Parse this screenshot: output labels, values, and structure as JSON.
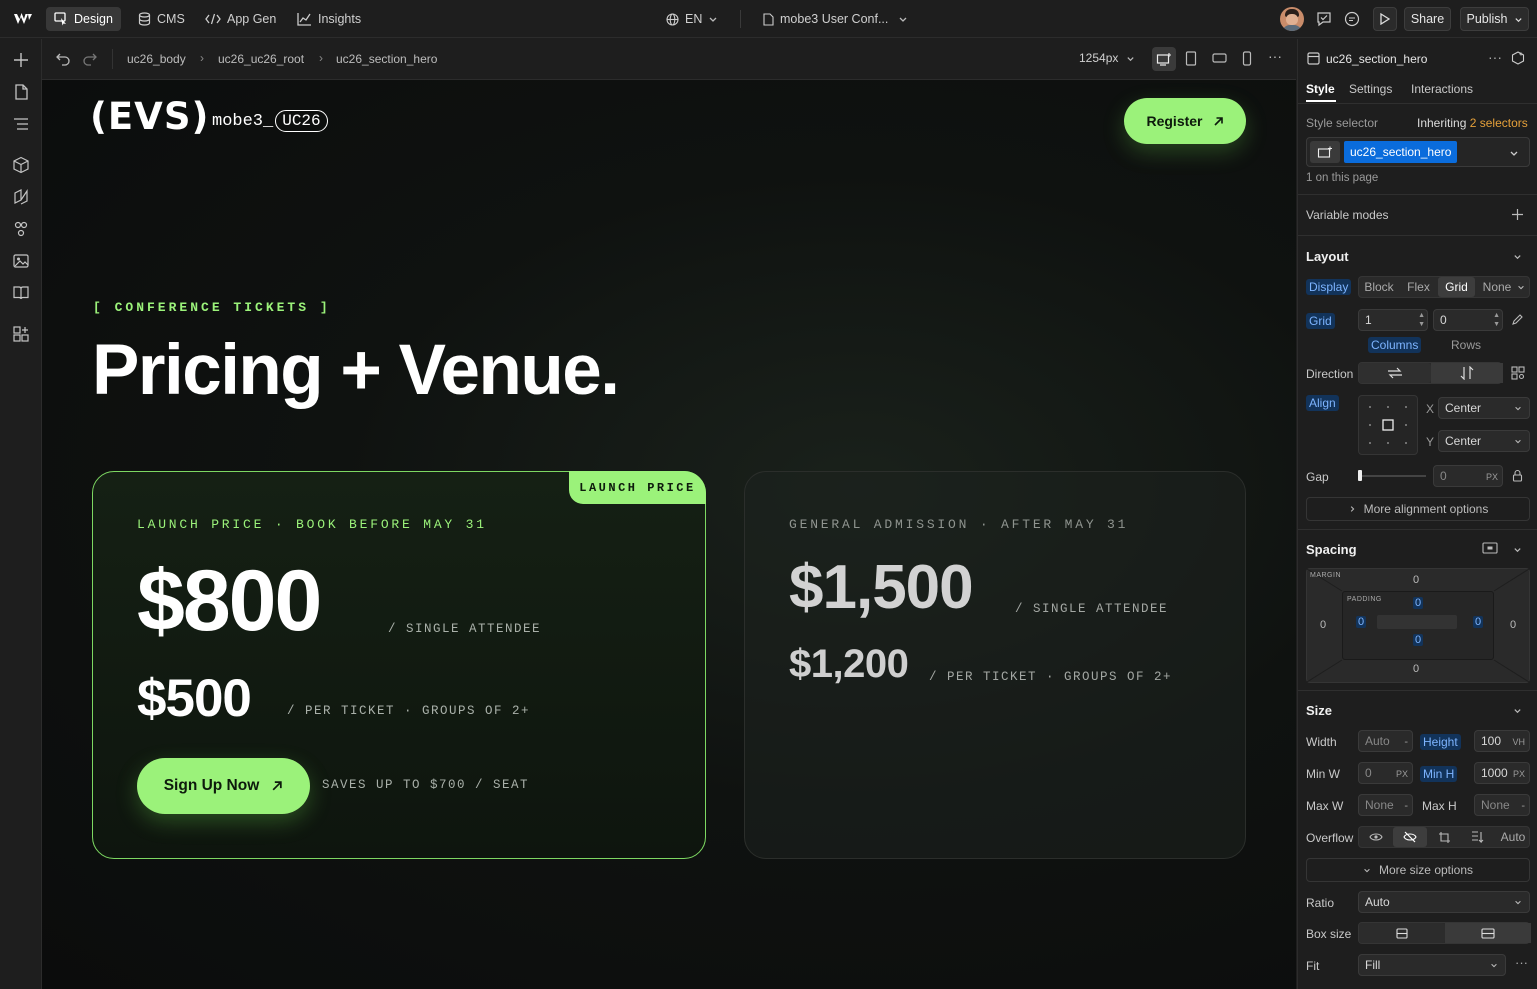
{
  "topbar": {
    "tabs": [
      {
        "label": "Design",
        "icon": "design-cursor-icon"
      },
      {
        "label": "CMS",
        "icon": "database-icon"
      },
      {
        "label": "App Gen",
        "icon": "code-icon"
      },
      {
        "label": "Insights",
        "icon": "chart-icon"
      }
    ],
    "language": "EN",
    "page_name": "mobe3 User Conf...",
    "share_label": "Share",
    "publish_label": "Publish"
  },
  "canvas_header": {
    "breadcrumbs": [
      "uc26_body",
      "uc26_uc26_root",
      "uc26_section_hero"
    ],
    "width_readout": "1254px"
  },
  "site": {
    "logo": "(EVS)",
    "brand_prefix": "mobe3_",
    "brand_tag": "UC26",
    "register_label": "Register",
    "eyebrow": "[ CONFERENCE TICKETS ]",
    "title": "Pricing + Venue.",
    "card_launch": {
      "ribbon": "LAUNCH PRICE",
      "label": "LAUNCH PRICE · BOOK BEFORE MAY 31",
      "price_single": "$800",
      "single_suffix": "/ SINGLE ATTENDEE",
      "price_group": "$500",
      "group_suffix": "/ PER TICKET · GROUPS OF 2+",
      "cta": "Sign Up Now",
      "savings": "SAVES UP TO $700 / SEAT"
    },
    "card_general": {
      "label": "GENERAL ADMISSION · AFTER MAY 31",
      "price_single": "$1,500",
      "single_suffix": "/ SINGLE ATTENDEE",
      "price_group": "$1,200",
      "group_suffix": "/ PER TICKET · GROUPS OF 2+"
    }
  },
  "panel": {
    "element_name": "uc26_section_hero",
    "tabs": [
      "Style",
      "Settings",
      "Interactions"
    ],
    "style_selector_label": "Style selector",
    "inheriting_prefix": "Inheriting",
    "inheriting_count": "2 selectors",
    "selector_chip": "uc26_section_hero",
    "on_page": "1 on this page",
    "variable_modes": "Variable modes",
    "layout": {
      "heading": "Layout",
      "display_label": "Display",
      "display_options": [
        "Block",
        "Flex",
        "Grid",
        "None"
      ],
      "grid_label": "Grid",
      "grid_columns": "1",
      "grid_rows": "0",
      "columns_label": "Columns",
      "rows_label": "Rows",
      "direction_label": "Direction",
      "align_label": "Align",
      "align_x_label": "X",
      "align_x": "Center",
      "align_y_label": "Y",
      "align_y": "Center",
      "gap_label": "Gap",
      "gap_value": "0",
      "gap_unit": "PX",
      "more_alignment": "More alignment options"
    },
    "spacing": {
      "heading": "Spacing",
      "margin_label": "MARGIN",
      "padding_label": "PADDING",
      "margin": {
        "top": "0",
        "right": "0",
        "bottom": "0",
        "left": "0"
      },
      "padding": {
        "top": "0",
        "right": "0",
        "bottom": "0",
        "left": "0"
      }
    },
    "size": {
      "heading": "Size",
      "width_label": "Width",
      "width_value": "Auto",
      "width_unit": "-",
      "height_label": "Height",
      "height_value": "100",
      "height_unit": "VH",
      "minw_label": "Min W",
      "minw_value": "0",
      "minw_unit": "PX",
      "minh_label": "Min H",
      "minh_value": "1000",
      "minh_unit": "PX",
      "maxw_label": "Max W",
      "maxw_value": "None",
      "maxw_unit": "-",
      "maxh_label": "Max H",
      "maxh_value": "None",
      "maxh_unit": "-",
      "overflow_label": "Overflow",
      "overflow_auto": "Auto",
      "more_size": "More size options",
      "ratio_label": "Ratio",
      "ratio_value": "Auto",
      "boxsize_label": "Box size",
      "fit_label": "Fit",
      "fit_value": "Fill"
    }
  },
  "colors": {
    "accent_green": "#9bf27a",
    "selector_blue": "#0a6cdc",
    "inherit_orange": "#e5a03a"
  }
}
